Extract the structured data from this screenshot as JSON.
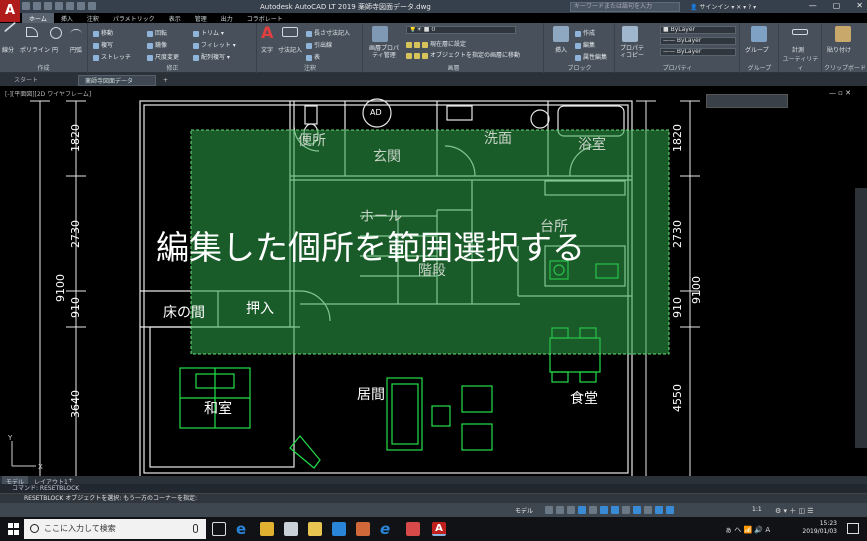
{
  "window": {
    "title": "Autodesk AutoCAD LT 2019    薬師寺図面データ.dwg",
    "search_placeholder": "キーワードまたは語句を入力",
    "user": "サインイン",
    "controls": [
      "—",
      "▢",
      "✕"
    ],
    "app_letter": "A"
  },
  "ribbon_tabs": [
    "ホーム",
    "挿入",
    "注釈",
    "パラメトリック",
    "表示",
    "管理",
    "出力",
    "コラボレート"
  ],
  "ribbon": {
    "draw": {
      "label": "作成",
      "tools": [
        "線分",
        "ポリライン",
        "円",
        "円弧"
      ]
    },
    "modify": {
      "label": "修正",
      "rows": [
        [
          "移動",
          "回転",
          "トリム",
          ""
        ],
        [
          "複写",
          "鏡像",
          "フィレット",
          ""
        ],
        [
          "ストレッチ",
          "尺度変更",
          "配列複写",
          ""
        ]
      ]
    },
    "annotation": {
      "label": "注釈",
      "text": "文字",
      "dim": "寸法記入",
      "rows": [
        "長さ寸法記入",
        "引出線",
        "表"
      ]
    },
    "layers": {
      "label": "画層",
      "props": "画層プロパティ管理",
      "combo": "0",
      "rows": [
        "現在層に設定",
        "オブジェクトを指定の画層に移動"
      ]
    },
    "block": {
      "label": "ブロック",
      "insert": "挿入",
      "rows": [
        "作成",
        "編集",
        "属性編集"
      ]
    },
    "properties": {
      "label": "プロパティ",
      "copy": "プロパティコピー",
      "combos": [
        "ByLayer",
        "ByLayer",
        "ByLayer"
      ]
    },
    "groups": {
      "label": "グループ",
      "btn": "グループ"
    },
    "utilities": {
      "label": "ユーティリティ",
      "btn": "計測"
    },
    "clipboard": {
      "label": "クリップボード",
      "btn": "貼り付け"
    }
  },
  "doc_tabs": {
    "start": "スタート",
    "file": "薬師寺図面データ",
    "add": "+"
  },
  "viewport": {
    "label": "[-][平面図][2D ワイヤフレーム]",
    "controls": "— ▫ ✕"
  },
  "overlay_text": "編集した個所を範囲選択する",
  "rooms": [
    {
      "key": "toilet",
      "label": "便所"
    },
    {
      "key": "entrance",
      "label": "玄関"
    },
    {
      "key": "washroom",
      "label": "洗面"
    },
    {
      "key": "bathroom",
      "label": "浴室"
    },
    {
      "key": "hall",
      "label": "ホール"
    },
    {
      "key": "kitchen",
      "label": "台所"
    },
    {
      "key": "stairs",
      "label": "階段"
    },
    {
      "key": "tokonoma",
      "label": "床の間"
    },
    {
      "key": "closet",
      "label": "押入"
    },
    {
      "key": "washitsu",
      "label": "和室"
    },
    {
      "key": "living",
      "label": "居間"
    },
    {
      "key": "dining",
      "label": "食堂"
    }
  ],
  "dims_left": [
    "1820",
    "2730",
    "910",
    "3640"
  ],
  "dims_right": [
    "1820",
    "2730",
    "910",
    "4550"
  ],
  "dim_total_left": "9100",
  "dim_total_right": "9100",
  "entrance_mark": "AD",
  "model_tabs": [
    "モデル",
    "レイアウト1",
    "+"
  ],
  "command": {
    "history": "コマンド: RESETBLOCK",
    "prompt": "RESETBLOCK オブジェクトを選択: もう一方のコーナーを指定:"
  },
  "statusbar": {
    "model": "モデル",
    "scale": "1:1"
  },
  "taskbar": {
    "search": "ここに入力して検索",
    "time": "15:23",
    "date": "2019/01/03",
    "tray": "ぁ ヘ 📶 🔊 A"
  },
  "colors": {
    "selection_fill": "#2fa84a",
    "wall": "#ffffff",
    "furniture": "#22e04a",
    "ribbon": "#47505b",
    "taskbar": "#101216"
  }
}
